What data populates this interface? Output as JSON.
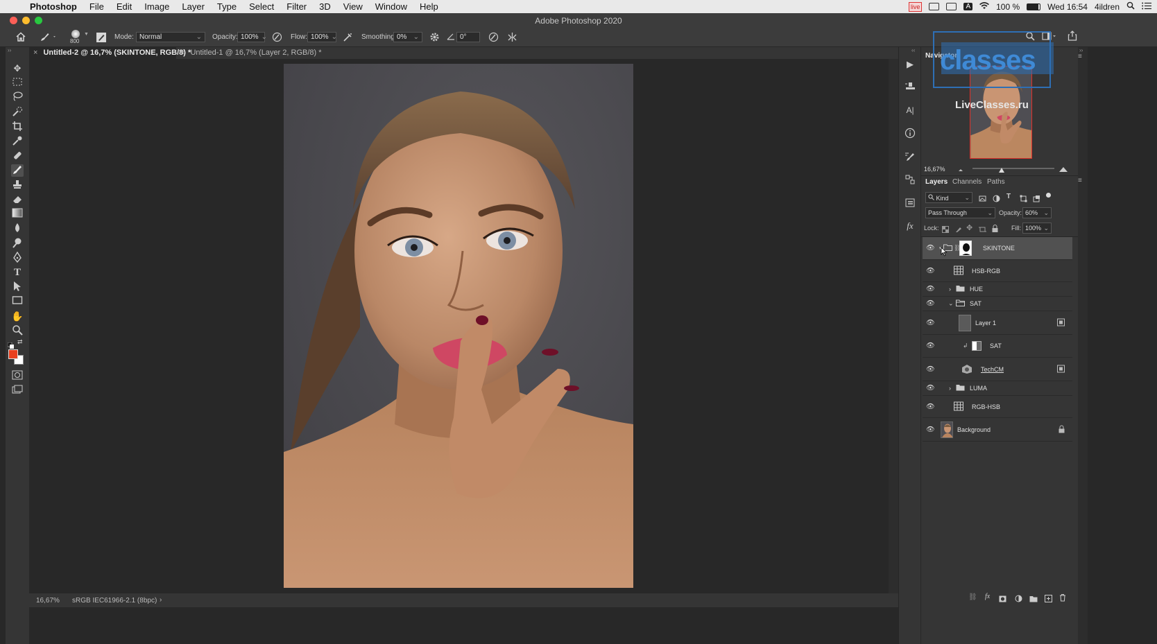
{
  "menubar": {
    "app": "Photoshop",
    "items": [
      "File",
      "Edit",
      "Image",
      "Layer",
      "Type",
      "Select",
      "Filter",
      "3D",
      "View",
      "Window",
      "Help"
    ],
    "live": "live",
    "battery": "100 %",
    "clock": "Wed 16:54",
    "user": "4ildren"
  },
  "window": {
    "title": "Adobe Photoshop 2020"
  },
  "options": {
    "brush_size": "800",
    "mode_label": "Mode:",
    "mode_value": "Normal",
    "opacity_label": "Opacity:",
    "opacity_value": "100%",
    "flow_label": "Flow:",
    "flow_value": "100%",
    "smoothing_label": "Smoothing:",
    "smoothing_value": "0%",
    "angle_value": "0°"
  },
  "tabs": [
    {
      "label": "Untitled-2 @ 16,7% (SKINTONE, RGB/8) *"
    },
    {
      "label": "Untitled-1 @ 16,7% (Layer 2, RGB/8) *"
    }
  ],
  "status": {
    "zoom": "16,67%",
    "profile": "sRGB IEC61966-2.1 (8bpc)",
    "arrow": "›"
  },
  "navigator": {
    "title": "Navigator",
    "zoom": "16,67%"
  },
  "watermark": {
    "line1": "classes",
    "line2": "LiveClasses.ru"
  },
  "layers_panel": {
    "tabs": [
      "Layers",
      "Channels",
      "Paths"
    ],
    "filter_kind": "Kind",
    "blend_mode": "Pass Through",
    "opacity_label": "Opacity:",
    "opacity_value": "60%",
    "lock_label": "Lock:",
    "fill_label": "Fill:",
    "fill_value": "100%",
    "layers": [
      {
        "name": "SKINTONE",
        "kind": "group-open",
        "selected": true
      },
      {
        "name": "HSB-RGB",
        "kind": "grid"
      },
      {
        "name": "HUE",
        "kind": "group-closed"
      },
      {
        "name": "SAT",
        "kind": "group-open"
      },
      {
        "name": "Layer 1",
        "kind": "pixel"
      },
      {
        "name": "SAT",
        "kind": "adjustment"
      },
      {
        "name": "TechCM",
        "kind": "smart"
      },
      {
        "name": "LUMA",
        "kind": "group-closed"
      },
      {
        "name": "RGB-HSB",
        "kind": "grid"
      },
      {
        "name": "Background",
        "kind": "background"
      }
    ]
  },
  "colors": {
    "foreground": "#e8401f",
    "background": "#ffffff",
    "accent_blue": "#2e6fb5"
  }
}
